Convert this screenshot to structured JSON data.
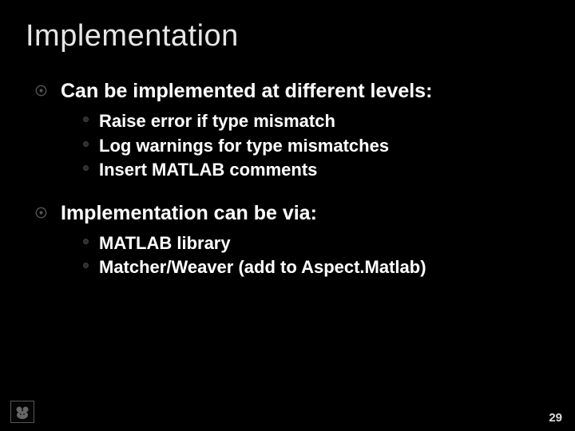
{
  "title": "Implementation",
  "points": [
    {
      "text": "Can be implemented  at different levels:",
      "subs": [
        "Raise error if type mismatch",
        "Log warnings for type mismatches",
        "Insert MATLAB comments"
      ]
    },
    {
      "text": "Implementation can be via:",
      "subs": [
        "MATLAB library",
        "Matcher/Weaver (add to Aspect.Matlab)"
      ]
    }
  ],
  "page_number": "29"
}
